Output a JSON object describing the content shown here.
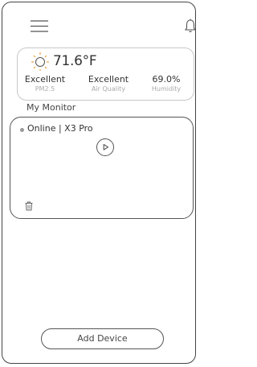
{
  "header": {
    "menu_icon": "hamburger-menu-icon",
    "notification_icon": "bell-icon"
  },
  "weather": {
    "icon": "sun-icon",
    "temperature": "71.6°F",
    "metrics": [
      {
        "value": "Excellent",
        "label": "PM2.5"
      },
      {
        "value": "Excellent",
        "label": "Air Quality"
      },
      {
        "value": "69.0%",
        "label": "Humidity"
      }
    ]
  },
  "monitor": {
    "section_title": "My Monitor",
    "device": {
      "status_text": "Online | X3 Pro",
      "play_icon": "play-icon",
      "delete_icon": "trash-icon"
    }
  },
  "footer": {
    "add_device_label": "Add Device"
  },
  "colors": {
    "border": "#444444",
    "text": "#333333",
    "muted": "#aaaaaa"
  }
}
